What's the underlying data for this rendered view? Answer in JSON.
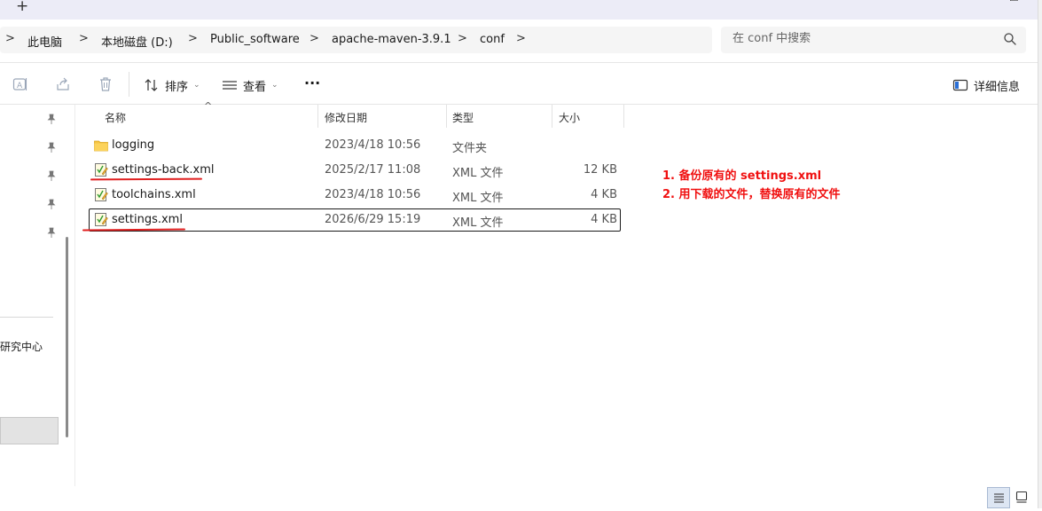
{
  "window": {
    "new_tab_glyph": "+",
    "minimize_glyph": "—",
    "maximize_glyph": "☐"
  },
  "breadcrumb": {
    "items": [
      "此电脑",
      "本地磁盘 (D:)",
      "Public_software",
      "apache-maven-3.9.1",
      "conf"
    ],
    "separator": ">"
  },
  "search": {
    "placeholder": "在 conf 中搜索"
  },
  "toolbar": {
    "sort_label": "排序",
    "view_label": "查看",
    "more_label": "···",
    "details_label": "详细信息"
  },
  "nav": {
    "partial_item": "研究中心"
  },
  "columns": {
    "name": "名称",
    "modified": "修改日期",
    "type": "类型",
    "size": "大小"
  },
  "files": [
    {
      "name": "logging",
      "modified": "2023/4/18 10:56",
      "type": "文件夹",
      "size": "",
      "icon": "folder-icon"
    },
    {
      "name": "settings-back.xml",
      "modified": "2025/2/17 11:08",
      "type": "XML 文件",
      "size": "12 KB",
      "icon": "xml-file-icon"
    },
    {
      "name": "toolchains.xml",
      "modified": "2023/4/18 10:56",
      "type": "XML 文件",
      "size": "4 KB",
      "icon": "xml-file-icon"
    },
    {
      "name": "settings.xml",
      "modified": "2026/6/29 15:19",
      "type": "XML 文件",
      "size": "4 KB",
      "icon": "xml-file-icon"
    }
  ],
  "annotations": {
    "step1": "1. 备份原有的 settings.xml",
    "step2": "2. 用下载的文件，替换原有的文件",
    "color": "#f01010"
  },
  "colors": {
    "selection_border": "#1a1a1a",
    "annotation_red": "#e02020",
    "folder_yellow": "#f5c342"
  }
}
